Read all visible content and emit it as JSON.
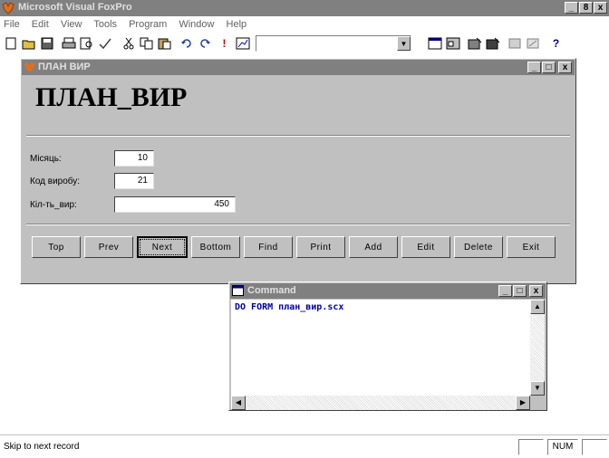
{
  "app": {
    "title": "Microsoft Visual FoxPro",
    "controls": [
      "_",
      "8",
      "x"
    ]
  },
  "menu": [
    "File",
    "Edit",
    "View",
    "Tools",
    "Program",
    "Window",
    "Help"
  ],
  "toolbar": {
    "icons": [
      "new-icon",
      "open-icon",
      "save-icon",
      "print-icon",
      "print-preview-icon",
      "spell-check-icon",
      "cut-icon",
      "copy-icon",
      "paste-icon",
      "undo-icon",
      "redo-icon",
      "run-icon",
      "modify-form-icon",
      "combo-dropdown-icon",
      "command-window-icon",
      "view-window-icon",
      "form-wizard-icon",
      "report-wizard-icon",
      "builder-icon",
      "autoform-icon",
      "help-icon"
    ],
    "combo_value": ""
  },
  "form": {
    "window_title": "ПЛАН ВИР",
    "controls": [
      "_",
      "□",
      "x"
    ],
    "heading": "ПЛАН_ВИР",
    "fields": [
      {
        "label": "Місяць:",
        "value": "10"
      },
      {
        "label": "Код виробу:",
        "value": "21"
      },
      {
        "label": "Кіл-ть_вир:",
        "value": "450"
      }
    ],
    "buttons": [
      "Top",
      "Prev",
      "Next",
      "Bottom",
      "Find",
      "Print",
      "Add",
      "Edit",
      "Delete",
      "Exit"
    ]
  },
  "command": {
    "window_title": "Command",
    "controls": [
      "_",
      "□",
      "x"
    ],
    "line": "DO FORM план_вир.scx"
  },
  "status": {
    "message": "Skip to next record",
    "num": "NUM"
  },
  "colors": {
    "desktop": "#ffffff",
    "face": "#c0c0c0",
    "inactive_title": "#808080",
    "command_text": "#0000a0"
  }
}
